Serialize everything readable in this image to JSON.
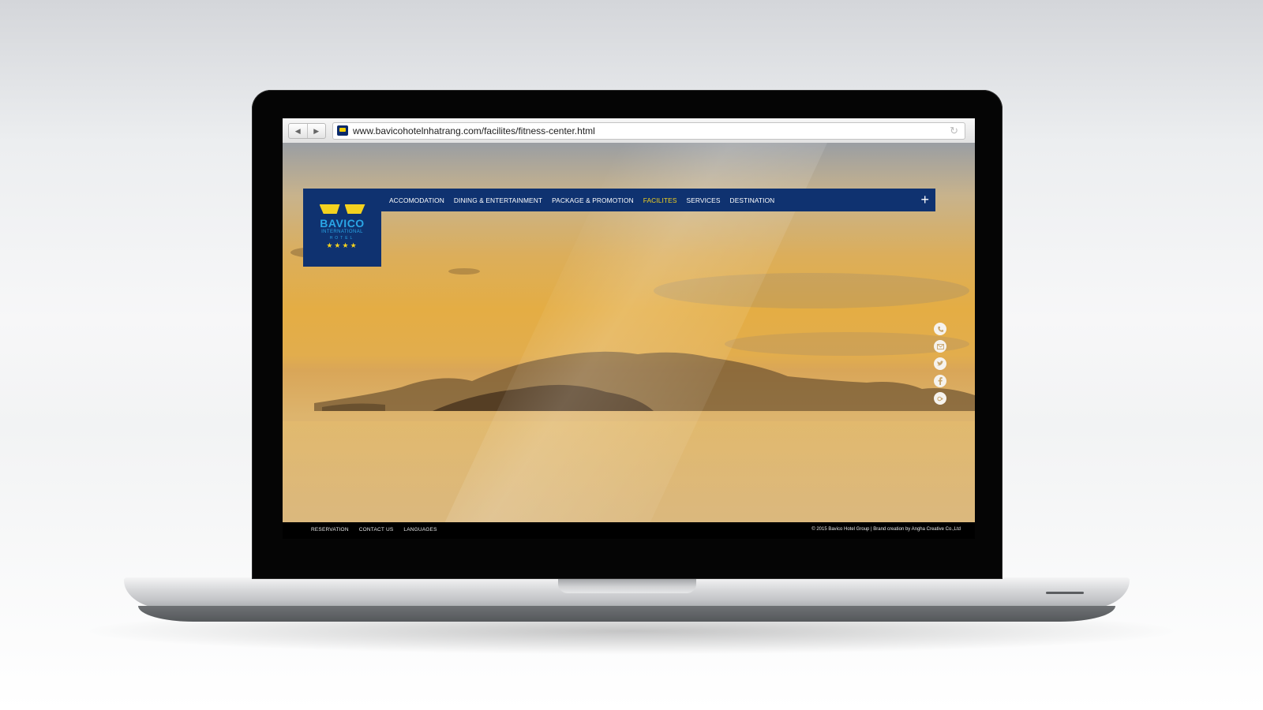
{
  "browser": {
    "back_icon": "◀",
    "forward_icon": "▶",
    "url": "www.bavicohotelnhatrang.com/facilites/fitness-center.html",
    "reload_icon": "↻"
  },
  "logo": {
    "name": "BAVICO",
    "subtitle": "INTERNATIONAL",
    "hotel": "HOTEL",
    "stars": "★★★★"
  },
  "nav": {
    "items": [
      {
        "label": "ACCOMODATION",
        "active": false
      },
      {
        "label": "DINING & ENTERTAINMENT",
        "active": false
      },
      {
        "label": "PACKAGE & PROMOTION",
        "active": false
      },
      {
        "label": "FACILITES",
        "active": true
      },
      {
        "label": "SERVICES",
        "active": false
      },
      {
        "label": "DESTINATION",
        "active": false
      }
    ],
    "expand_icon": "+"
  },
  "social": {
    "icons": [
      "phone-icon",
      "mail-icon",
      "twitter-icon",
      "facebook-icon",
      "google-plus-icon"
    ]
  },
  "footer": {
    "links": [
      "RESERVATION",
      "CONTACT US",
      "LANGUAGES"
    ],
    "copyright": "© 2015 Bavico Hotel Group | Brand creation by Angha Creative Co.,Ltd"
  },
  "colors": {
    "brand_blue": "#0f3270",
    "brand_yellow": "#f4d21f",
    "brand_light_blue": "#2aa6e6"
  }
}
